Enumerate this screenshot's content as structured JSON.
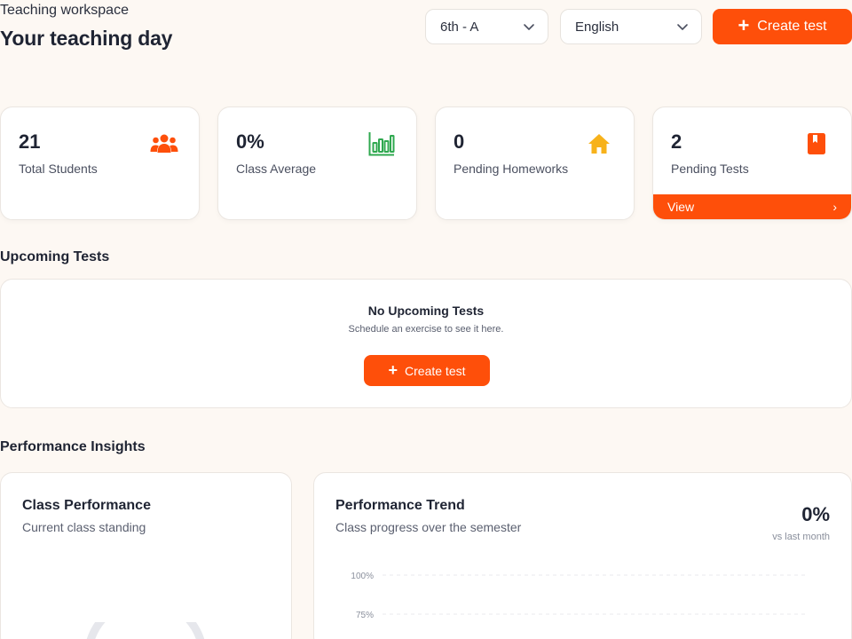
{
  "header": {
    "eyebrow": "Teaching workspace",
    "title": "Your teaching day",
    "class_select": "6th - A",
    "subject_select": "English",
    "create_test_label": "Create test"
  },
  "stats": [
    {
      "value": "21",
      "label": "Total Students",
      "icon": "users-icon"
    },
    {
      "value": "0%",
      "label": "Class Average",
      "icon": "bar-chart-icon"
    },
    {
      "value": "0",
      "label": "Pending Homeworks",
      "icon": "home-icon"
    },
    {
      "value": "2",
      "label": "Pending Tests",
      "icon": "book-icon",
      "action_label": "View",
      "action_arrow": "›"
    }
  ],
  "upcoming": {
    "title": "Upcoming Tests",
    "empty_title": "No Upcoming Tests",
    "empty_subtitle": "Schedule an exercise to see it here.",
    "create_label": "Create test"
  },
  "insights": {
    "title": "Performance Insights",
    "class_performance": {
      "title": "Class Performance",
      "subtitle": "Current class standing"
    },
    "trend": {
      "title": "Performance Trend",
      "subtitle": "Class progress over the semester",
      "value": "0%",
      "note": "vs last month",
      "y_ticks": [
        "100%",
        "75%"
      ]
    }
  },
  "colors": {
    "accent": "#fe4f0a",
    "icon_users": "#fe4f0a",
    "icon_chart": "#2fa84f",
    "icon_home": "#f7b21b",
    "icon_book": "#fe4f0a"
  }
}
